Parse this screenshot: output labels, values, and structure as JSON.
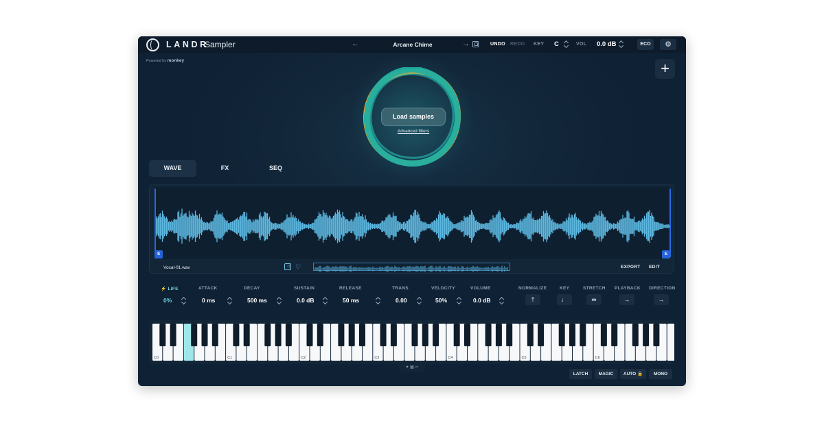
{
  "titlebar": {
    "brand": "LANDR",
    "app_name": "Sampler",
    "back_arrow": "←",
    "preset_name": "Arcane Chime",
    "forward_arrow": "→",
    "undo": "UNDO",
    "redo": "REDO",
    "key_label": "KEY",
    "key_value": "C",
    "vol_label": "VOL",
    "vol_value": "0.0 dB",
    "eco": "ECO",
    "settings_icon": "⚙"
  },
  "powered_by": {
    "prefix": "Powered by",
    "name": "monkey"
  },
  "add_button": "+",
  "center": {
    "load_samples": "Load samples",
    "advanced_filters": "Advanced filters"
  },
  "tabs": [
    {
      "label": "WAVE",
      "active": true
    },
    {
      "label": "FX",
      "active": false
    },
    {
      "label": "SEQ",
      "active": false
    }
  ],
  "wave_panel": {
    "file_name": "Vocal-01.wav",
    "start_marker": "S",
    "end_marker": "E",
    "export": "EXPORT",
    "edit": "EDIT",
    "waveform_color": "#5cb8e0"
  },
  "params": {
    "life": {
      "icon": "⚡",
      "label": "LIFE",
      "value": "0%"
    },
    "attack": {
      "label": "ATTACK",
      "value": "0 ms"
    },
    "decay": {
      "label": "DECAY",
      "value": "500 ms"
    },
    "sustain": {
      "label": "SUSTAIN",
      "value": "0.0 dB"
    },
    "release": {
      "label": "RELEASE",
      "value": "50 ms"
    },
    "trans": {
      "label": "TRANS",
      "value": "0.00"
    },
    "velocity": {
      "label": "VELOCITY",
      "value": "50%"
    },
    "volume": {
      "label": "VOLUME",
      "value": "0.0 dB"
    },
    "normalize": {
      "label": "NORMALIZE",
      "icon": "⤒"
    },
    "key": {
      "label": "KEY",
      "icon": "♩"
    },
    "stretch": {
      "label": "STRETCH",
      "icon": "⇹"
    },
    "playback": {
      "label": "PLAYBACK",
      "icon": "→"
    },
    "direction": {
      "label": "DIRECTION",
      "icon": "→"
    }
  },
  "keyboard": {
    "octave_labels": [
      "C0",
      "C1",
      "C2",
      "C3",
      "C4",
      "C5",
      "C6"
    ],
    "highlighted_key": "F0",
    "highlight_color": "#9fe6ea"
  },
  "footer": {
    "latch": "LATCH",
    "magic": "MAGIC",
    "auto": "AUTO 🔒",
    "mono": "MONO",
    "mode_icons": "✦ ▦ ✂"
  },
  "accent_colors": {
    "orb_teal": "#1fb0a3",
    "orb_orange": "#f2a01e",
    "life_cyan": "#6fd3e4"
  }
}
